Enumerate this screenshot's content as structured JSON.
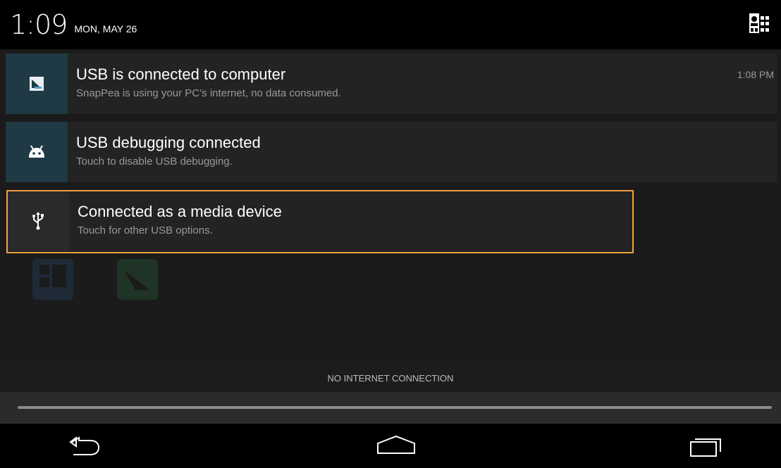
{
  "header": {
    "time": "1:09",
    "date": "MON, MAY 26",
    "settings_icon": "quick-settings-icon"
  },
  "notifications": [
    {
      "title": "USB is connected to computer",
      "subtitle": "SnapPea is using your PC’s internet, no data consumed.",
      "time": "1:08 PM",
      "icon": "snappea-icon"
    },
    {
      "title": "USB debugging connected",
      "subtitle": "Touch to disable USB debugging.",
      "icon": "android-icon"
    },
    {
      "title": "Connected as a media device",
      "subtitle": "Touch for other USB options.",
      "icon": "usb-icon"
    }
  ],
  "status": {
    "no_internet": "NO INTERNET CONNECTION"
  },
  "navbar": {
    "back_icon": "back-icon",
    "home_icon": "home-icon",
    "recents_icon": "recents-icon"
  },
  "colors": {
    "highlight": "#f0a040",
    "icon_bg_teal": "#1f3a45"
  }
}
